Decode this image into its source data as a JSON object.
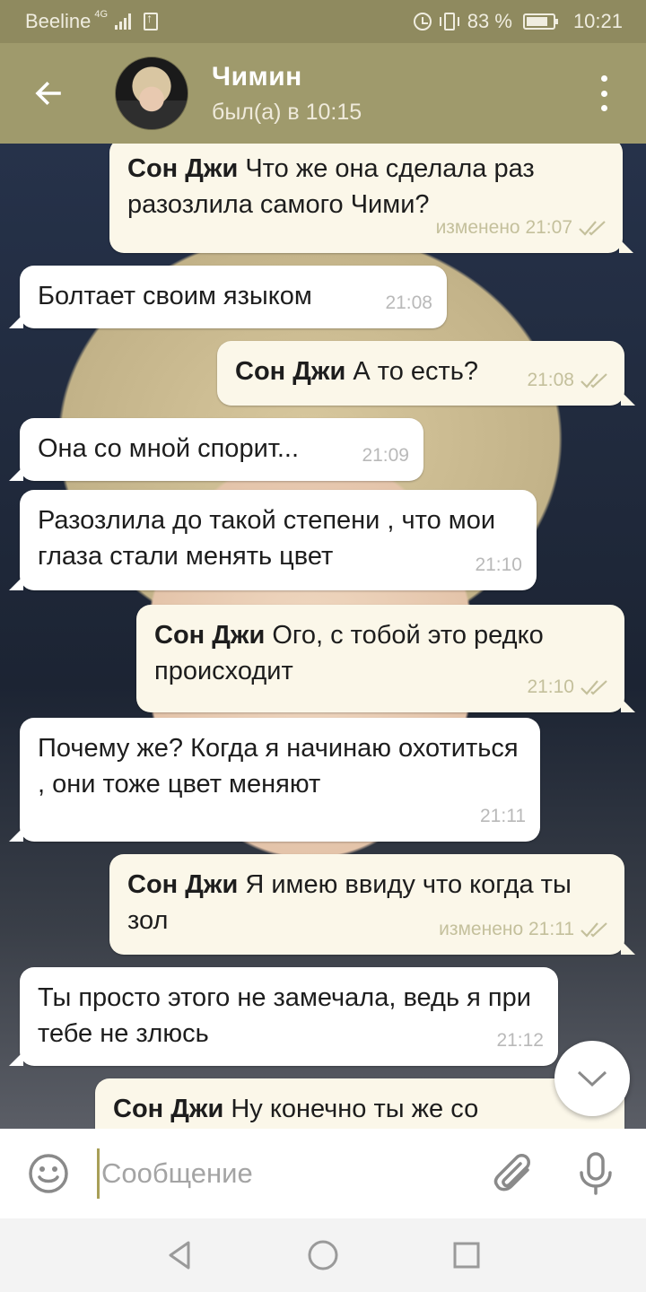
{
  "status_bar": {
    "carrier": "Beeline",
    "network": "4G",
    "battery": "83 %",
    "battery_level": 0.83,
    "time": "10:21"
  },
  "header": {
    "contact_name": "Чимин",
    "last_seen": "был(а) в 10:15"
  },
  "messages": [
    {
      "dir": "out",
      "sender": "Сон Джи",
      "text": "Что же она сделала раз разозлила самого Чими?",
      "meta": "изменено 21:07",
      "read": true
    },
    {
      "dir": "in",
      "text": "Болтает своим языком",
      "meta": "21:08"
    },
    {
      "dir": "out",
      "sender": "Сон Джи",
      "text": "А то есть?",
      "meta": "21:08",
      "read": true
    },
    {
      "dir": "in",
      "text": "Она со мной спорит...",
      "meta": "21:09"
    },
    {
      "dir": "in",
      "text": "Разозлила до такой степени , что мои глаза стали менять цвет",
      "meta": "21:10"
    },
    {
      "dir": "out",
      "sender": "Сон Джи",
      "text": "Ого, с тобой это редко происходит",
      "meta": "21:10",
      "read": true
    },
    {
      "dir": "in",
      "text": "Почему же? Когда я начинаю охотиться , они тоже цвет меняют",
      "meta": "21:11"
    },
    {
      "dir": "out",
      "sender": "Сон Джи",
      "text": "Я имею ввиду что когда ты зол",
      "meta": "изменено 21:11",
      "read": true
    },
    {
      "dir": "in",
      "text": "Ты просто этого не замечала, ведь я при тебе не злюсь",
      "meta": "21:12"
    },
    {
      "dir": "out",
      "sender": "Сон Джи",
      "text": "Ну конечно ты же со",
      "meta": "",
      "read": false
    }
  ],
  "input": {
    "placeholder": "Сообщение"
  },
  "colors": {
    "header": "#9f9a6c",
    "status_bar": "#8f8a5f",
    "outgoing_bubble": "#fbf7e9",
    "incoming_bubble": "#ffffff",
    "read_check": "#c4c09c"
  },
  "icons": {
    "back": "arrow-left-icon",
    "menu": "more-vertical-icon",
    "emoji": "smiley-icon",
    "attach": "paperclip-icon",
    "mic": "microphone-icon",
    "scroll": "chevron-down-icon"
  }
}
